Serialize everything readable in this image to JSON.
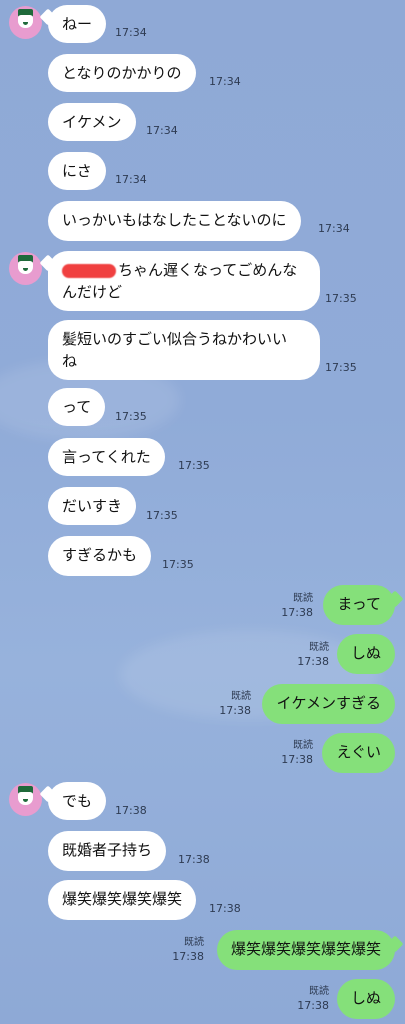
{
  "messages_in": [
    {
      "text": "ねー",
      "time": "17:34"
    },
    {
      "text": "となりのかかりの",
      "time": "17:34"
    },
    {
      "text": "イケメン",
      "time": "17:34"
    },
    {
      "text": "にさ",
      "time": "17:34"
    },
    {
      "text": "いっかいもはなしたことないのに",
      "time": "17:34"
    },
    {
      "text_line1": "ちゃん遅くなってごめんな",
      "text_line2": "んだけど",
      "time": "17:35"
    },
    {
      "text_line1": "髪短いのすごい似合うねかわいい",
      "text_line2": "ね",
      "time": "17:35"
    },
    {
      "text": "って",
      "time": "17:35"
    },
    {
      "text": "言ってくれた",
      "time": "17:35"
    },
    {
      "text": "だいすき",
      "time": "17:35"
    },
    {
      "text": "すぎるかも",
      "time": "17:35"
    },
    {
      "text": "でも",
      "time": "17:38"
    },
    {
      "text": "既婚者子持ち",
      "time": "17:38"
    },
    {
      "text": "爆笑爆笑爆笑爆笑",
      "time": "17:38"
    }
  ],
  "messages_out": [
    {
      "text": "まって",
      "read": "既読",
      "time": "17:38"
    },
    {
      "text": "しぬ",
      "read": "既読",
      "time": "17:38"
    },
    {
      "text": "イケメンすぎる",
      "read": "既読",
      "time": "17:38"
    },
    {
      "text": "えぐい",
      "read": "既読",
      "time": "17:38"
    },
    {
      "text": "爆笑爆笑爆笑爆笑爆笑",
      "read": "既読",
      "time": "17:38"
    },
    {
      "text": "しぬ",
      "read": "既読",
      "time": "17:38"
    }
  ],
  "colors": {
    "incoming_bubble": "#ffffff",
    "outgoing_bubble": "#85e07a",
    "background": "#8fa9d6",
    "avatar": "#e89ccf",
    "redaction": "#f04040"
  },
  "icons": [
    "avatar-icon"
  ]
}
